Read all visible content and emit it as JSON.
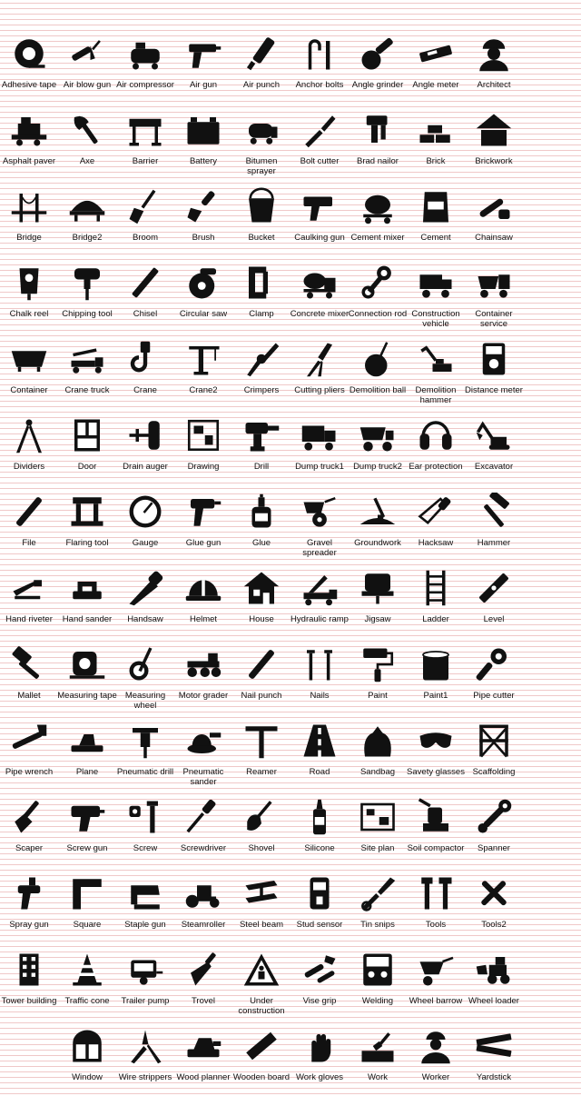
{
  "icons": [
    {
      "label": "Adhesive tape",
      "icon": "tape-icon"
    },
    {
      "label": "Air blow gun",
      "icon": "air-blow-gun-icon"
    },
    {
      "label": "Air compressor",
      "icon": "air-compressor-icon"
    },
    {
      "label": "Air gun",
      "icon": "air-gun-icon"
    },
    {
      "label": "Air punch",
      "icon": "air-punch-icon"
    },
    {
      "label": "Anchor bolts",
      "icon": "anchor-bolts-icon"
    },
    {
      "label": "Angle grinder",
      "icon": "angle-grinder-icon"
    },
    {
      "label": "Angle meter",
      "icon": "angle-meter-icon"
    },
    {
      "label": "Architect",
      "icon": "architect-icon"
    },
    {
      "label": "Asphalt paver",
      "icon": "asphalt-paver-icon"
    },
    {
      "label": "Axe",
      "icon": "axe-icon"
    },
    {
      "label": "Barrier",
      "icon": "barrier-icon"
    },
    {
      "label": "Battery",
      "icon": "battery-icon"
    },
    {
      "label": "Bitumen sprayer",
      "icon": "bitumen-sprayer-icon"
    },
    {
      "label": "Bolt cutter",
      "icon": "bolt-cutter-icon"
    },
    {
      "label": "Brad nailor",
      "icon": "brad-nailor-icon"
    },
    {
      "label": "Brick",
      "icon": "brick-icon"
    },
    {
      "label": "Brickwork",
      "icon": "brickwork-icon"
    },
    {
      "label": "Bridge",
      "icon": "bridge-icon"
    },
    {
      "label": "Bridge2",
      "icon": "bridge2-icon"
    },
    {
      "label": "Broom",
      "icon": "broom-icon"
    },
    {
      "label": "Brush",
      "icon": "brush-icon"
    },
    {
      "label": "Bucket",
      "icon": "bucket-icon"
    },
    {
      "label": "Caulking gun",
      "icon": "caulking-gun-icon"
    },
    {
      "label": "Cement mixer",
      "icon": "cement-mixer-icon"
    },
    {
      "label": "Cement",
      "icon": "cement-bag-icon"
    },
    {
      "label": "Chainsaw",
      "icon": "chainsaw-icon"
    },
    {
      "label": "Chalk reel",
      "icon": "chalk-reel-icon"
    },
    {
      "label": "Chipping tool",
      "icon": "chipping-tool-icon"
    },
    {
      "label": "Chisel",
      "icon": "chisel-icon"
    },
    {
      "label": "Circular saw",
      "icon": "circular-saw-icon"
    },
    {
      "label": "Clamp",
      "icon": "clamp-icon"
    },
    {
      "label": "Concrete mixer",
      "icon": "concrete-mixer-icon"
    },
    {
      "label": "Connection rod",
      "icon": "connection-rod-icon"
    },
    {
      "label": "Construction vehicle",
      "icon": "construction-vehicle-icon"
    },
    {
      "label": "Container service",
      "icon": "container-service-icon"
    },
    {
      "label": "Container",
      "icon": "container-icon"
    },
    {
      "label": "Crane truck",
      "icon": "crane-truck-icon"
    },
    {
      "label": "Crane",
      "icon": "crane-hook-icon"
    },
    {
      "label": "Crane2",
      "icon": "tower-crane-icon"
    },
    {
      "label": "Crimpers",
      "icon": "crimpers-icon"
    },
    {
      "label": "Cutting pliers",
      "icon": "cutting-pliers-icon"
    },
    {
      "label": "Demolition ball",
      "icon": "demolition-ball-icon"
    },
    {
      "label": "Demolition hammer",
      "icon": "demolition-hammer-icon"
    },
    {
      "label": "Distance meter",
      "icon": "distance-meter-icon"
    },
    {
      "label": "Dividers",
      "icon": "dividers-icon"
    },
    {
      "label": "Door",
      "icon": "door-icon"
    },
    {
      "label": "Drain auger",
      "icon": "drain-auger-icon"
    },
    {
      "label": "Drawing",
      "icon": "drawing-icon"
    },
    {
      "label": "Drill",
      "icon": "drill-icon"
    },
    {
      "label": "Dump truck1",
      "icon": "dump-truck-icon"
    },
    {
      "label": "Dump truck2",
      "icon": "dump-truck2-icon"
    },
    {
      "label": "Ear protection",
      "icon": "ear-protection-icon"
    },
    {
      "label": "Excavator",
      "icon": "excavator-icon"
    },
    {
      "label": "File",
      "icon": "file-tool-icon"
    },
    {
      "label": "Flaring tool",
      "icon": "flaring-tool-icon"
    },
    {
      "label": "Gauge",
      "icon": "gauge-icon"
    },
    {
      "label": "Glue gun",
      "icon": "glue-gun-icon"
    },
    {
      "label": "Glue",
      "icon": "glue-bottle-icon"
    },
    {
      "label": "Gravel spreader",
      "icon": "gravel-spreader-icon"
    },
    {
      "label": "Groundwork",
      "icon": "groundwork-icon"
    },
    {
      "label": "Hacksaw",
      "icon": "hacksaw-icon"
    },
    {
      "label": "Hammer",
      "icon": "hammer-icon"
    },
    {
      "label": "Hand riveter",
      "icon": "hand-riveter-icon"
    },
    {
      "label": "Hand sander",
      "icon": "hand-sander-icon"
    },
    {
      "label": "Handsaw",
      "icon": "handsaw-icon"
    },
    {
      "label": "Helmet",
      "icon": "helmet-icon"
    },
    {
      "label": "House",
      "icon": "house-icon"
    },
    {
      "label": "Hydraulic ramp",
      "icon": "hydraulic-ramp-icon"
    },
    {
      "label": "Jigsaw",
      "icon": "jigsaw-icon"
    },
    {
      "label": "Ladder",
      "icon": "ladder-icon"
    },
    {
      "label": "Level",
      "icon": "level-icon"
    },
    {
      "label": "Mallet",
      "icon": "mallet-icon"
    },
    {
      "label": "Measuring tape",
      "icon": "measuring-tape-icon"
    },
    {
      "label": "Measuring wheel",
      "icon": "measuring-wheel-icon"
    },
    {
      "label": "Motor grader",
      "icon": "motor-grader-icon"
    },
    {
      "label": "Nail punch",
      "icon": "nail-punch-icon"
    },
    {
      "label": "Nails",
      "icon": "nails-icon"
    },
    {
      "label": "Paint",
      "icon": "paint-roller-icon"
    },
    {
      "label": "Paint1",
      "icon": "paint-can-icon"
    },
    {
      "label": "Pipe cutter",
      "icon": "pipe-cutter-icon"
    },
    {
      "label": "Pipe wrench",
      "icon": "pipe-wrench-icon"
    },
    {
      "label": "Plane",
      "icon": "plane-tool-icon"
    },
    {
      "label": "Pneumatic drill",
      "icon": "pneumatic-drill-icon"
    },
    {
      "label": "Pneumatic sander",
      "icon": "pneumatic-sander-icon"
    },
    {
      "label": "Reamer",
      "icon": "reamer-icon"
    },
    {
      "label": "Road",
      "icon": "road-icon"
    },
    {
      "label": "Sandbag",
      "icon": "sandbag-icon"
    },
    {
      "label": "Savety glasses",
      "icon": "safety-glasses-icon"
    },
    {
      "label": "Scaffolding",
      "icon": "scaffolding-icon"
    },
    {
      "label": "Scaper",
      "icon": "scraper-icon"
    },
    {
      "label": "Screw gun",
      "icon": "screw-gun-icon"
    },
    {
      "label": "Screw",
      "icon": "screw-icon"
    },
    {
      "label": "Screwdriver",
      "icon": "screwdriver-icon"
    },
    {
      "label": "Shovel",
      "icon": "shovel-icon"
    },
    {
      "label": "Silicone",
      "icon": "silicone-icon"
    },
    {
      "label": "Site plan",
      "icon": "site-plan-icon"
    },
    {
      "label": "Soil compactor",
      "icon": "soil-compactor-icon"
    },
    {
      "label": "Spanner",
      "icon": "spanner-icon"
    },
    {
      "label": "Spray gun",
      "icon": "spray-gun-icon"
    },
    {
      "label": "Square",
      "icon": "square-ruler-icon"
    },
    {
      "label": "Staple gun",
      "icon": "staple-gun-icon"
    },
    {
      "label": "Steamroller",
      "icon": "steamroller-icon"
    },
    {
      "label": "Steel beam",
      "icon": "steel-beam-icon"
    },
    {
      "label": "Stud sensor",
      "icon": "stud-sensor-icon"
    },
    {
      "label": "Tin snips",
      "icon": "tin-snips-icon"
    },
    {
      "label": "Tools",
      "icon": "tools-icon"
    },
    {
      "label": "Tools2",
      "icon": "tools2-icon"
    },
    {
      "label": "Tower building",
      "icon": "tower-building-icon"
    },
    {
      "label": "Traffic cone",
      "icon": "traffic-cone-icon"
    },
    {
      "label": "Trailer pump",
      "icon": "trailer-pump-icon"
    },
    {
      "label": "Trovel",
      "icon": "trowel-icon"
    },
    {
      "label": "Under construction",
      "icon": "under-construction-icon"
    },
    {
      "label": "Vise grip",
      "icon": "vise-grip-icon"
    },
    {
      "label": "Welding",
      "icon": "welding-icon"
    },
    {
      "label": "Wheel barrow",
      "icon": "wheelbarrow-icon"
    },
    {
      "label": "Wheel loader",
      "icon": "wheel-loader-icon"
    },
    {
      "label": "Window",
      "icon": "window-icon"
    },
    {
      "label": "Wire strippers",
      "icon": "wire-strippers-icon"
    },
    {
      "label": "Wood planner",
      "icon": "wood-planer-icon"
    },
    {
      "label": "Wooden board",
      "icon": "wooden-board-icon"
    },
    {
      "label": "Work gloves",
      "icon": "work-gloves-icon"
    },
    {
      "label": "Work",
      "icon": "work-icon"
    },
    {
      "label": "Worker",
      "icon": "worker-icon"
    },
    {
      "label": "Yardstick",
      "icon": "yardstick-icon"
    }
  ],
  "colors": {
    "icon": "#111111",
    "line": "#f0c8c8",
    "background": "#ffffff"
  }
}
